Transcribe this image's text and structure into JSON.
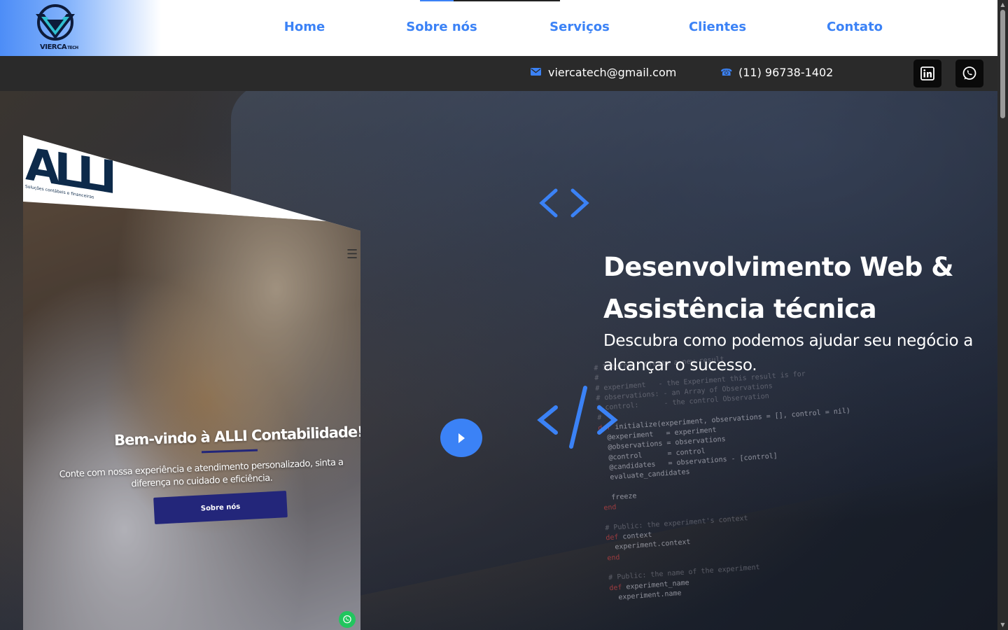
{
  "brand": {
    "name": "VIERCA",
    "suffix": "TECH",
    "accent": "#3b82f6"
  },
  "nav": {
    "items": [
      {
        "label": "Home"
      },
      {
        "label": "Sobre nós"
      },
      {
        "label": "Serviços"
      },
      {
        "label": "Clientes"
      },
      {
        "label": "Contato"
      }
    ]
  },
  "contact": {
    "email": "viercatech@gmail.com",
    "phone": "(11) 96738-1402",
    "email_icon": "envelope-icon",
    "phone_icon": "phone-icon"
  },
  "social": [
    {
      "name": "linkedin-icon"
    },
    {
      "name": "whatsapp-icon"
    }
  ],
  "mockup": {
    "logo": "ALLI",
    "logo_sub": "Soluções contábeis e financeiras",
    "title": "Bem-vindo à ALLI Contabilidade!",
    "description": "Conte com nossa experiência e atendimento personalizado, sinta a diferença no cuidado e eficiência.",
    "button": "Sobre nós"
  },
  "hero": {
    "title": "Desenvolvimento Web & Assistência técnica",
    "subtitle": "Descubra como podemos ajudar seu negócio a alcançar o sucesso."
  }
}
